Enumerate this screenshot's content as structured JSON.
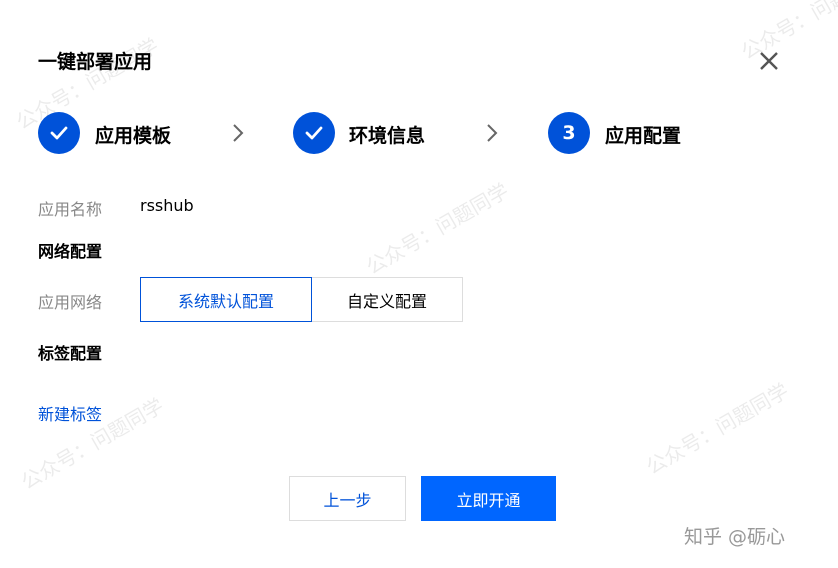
{
  "dialog": {
    "title": "一键部署应用",
    "close_icon": "close-icon"
  },
  "steps": [
    {
      "label": "应用模板",
      "state": "done",
      "icon": "check-icon"
    },
    {
      "label": "环境信息",
      "state": "done",
      "icon": "check-icon"
    },
    {
      "label": "应用配置",
      "state": "current",
      "number": "3"
    }
  ],
  "form": {
    "app_name_label": "应用名称",
    "app_name_value": "rsshub",
    "network_section": "网络配置",
    "network_label": "应用网络",
    "network_options": [
      "系统默认配置",
      "自定义配置"
    ],
    "network_selected": "系统默认配置",
    "tag_section": "标签配置",
    "new_tag_link": "新建标签"
  },
  "footer": {
    "prev_label": "上一步",
    "submit_label": "立即开通"
  },
  "watermark": {
    "text": "公众号：问题同学",
    "attribution": "知乎 @砺心"
  },
  "colors": {
    "accent": "#0052d9",
    "primary_button": "#0066ff"
  }
}
